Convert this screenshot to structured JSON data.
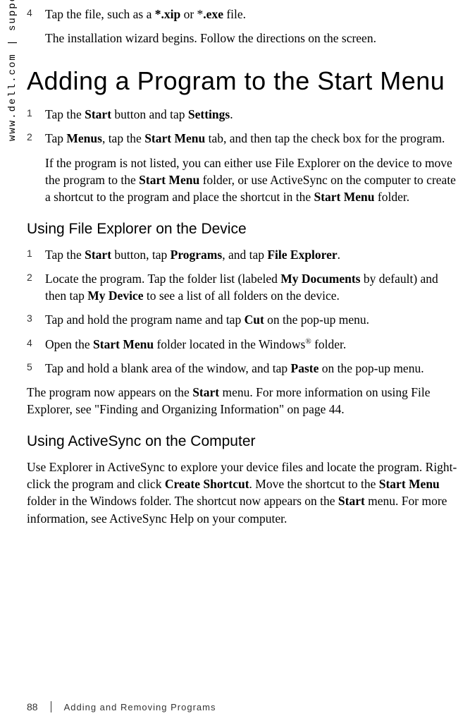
{
  "sidebar": "www.dell.com | support.dell.com",
  "topStep": {
    "num": "4",
    "p1_a": "Tap the file, such as a ",
    "p1_b": "*.xip",
    "p1_c": " or *",
    "p1_d": ".exe",
    "p1_e": " file.",
    "p2": "The installation wizard begins. Follow the directions on the screen."
  },
  "h1": "Adding a Program to the Start Menu",
  "s1": {
    "num": "1",
    "a": "Tap the ",
    "b": "Start",
    "c": " button and tap ",
    "d": "Settings",
    "e": "."
  },
  "s2": {
    "num": "2",
    "p1_a": "Tap ",
    "p1_b": "Menus",
    "p1_c": ", tap the ",
    "p1_d": "Start Menu",
    "p1_e": " tab, and then tap the check box for the program.",
    "p2_a": "If the program is not listed, you can either use File Explorer on the device to move the program to the ",
    "p2_b": "Start Menu",
    "p2_c": " folder, or use ActiveSync on the computer to create a shortcut to the program and place the shortcut in the ",
    "p2_d": "Start Menu",
    "p2_e": " folder."
  },
  "h2a": "Using File Explorer on the Device",
  "fe1": {
    "num": "1",
    "a": "Tap the ",
    "b": "Start",
    "c": " button, tap ",
    "d": "Programs",
    "e": ", and tap ",
    "f": "File Explorer",
    "g": "."
  },
  "fe2": {
    "num": "2",
    "a": "Locate the program. Tap the folder list (labeled ",
    "b": "My Documents",
    "c": " by default) and then tap ",
    "d": "My Device",
    "e": " to see a list of all folders on the device."
  },
  "fe3": {
    "num": "3",
    "a": "Tap and hold the program name and tap ",
    "b": "Cut",
    "c": " on the pop-up menu."
  },
  "fe4": {
    "num": "4",
    "a": "Open the ",
    "b": "Start Menu",
    "c": " folder located in the Windows",
    "sup": "®",
    "d": " folder."
  },
  "fe5": {
    "num": "5",
    "a": "Tap and hold a blank area of the window, and tap ",
    "b": "Paste",
    "c": " on the pop-up menu."
  },
  "para1_a": "The program now appears on the ",
  "para1_b": "Start",
  "para1_c": " menu. For more information on using File Explorer, see \"Finding and Organizing Information\" on page 44.",
  "h2b": "Using ActiveSync on the Computer",
  "para2_a": "Use Explorer in ActiveSync to explore your device files and locate the program. Right-click the program and click ",
  "para2_b": "Create Shortcut",
  "para2_c": ". Move the shortcut to the ",
  "para2_d": "Start Menu",
  "para2_e": " folder in the Windows folder. The shortcut now appears on the ",
  "para2_f": "Start",
  "para2_g": " menu. For more information, see ActiveSync Help on your computer.",
  "footer": {
    "page": "88",
    "title": "Adding and Removing Programs"
  }
}
